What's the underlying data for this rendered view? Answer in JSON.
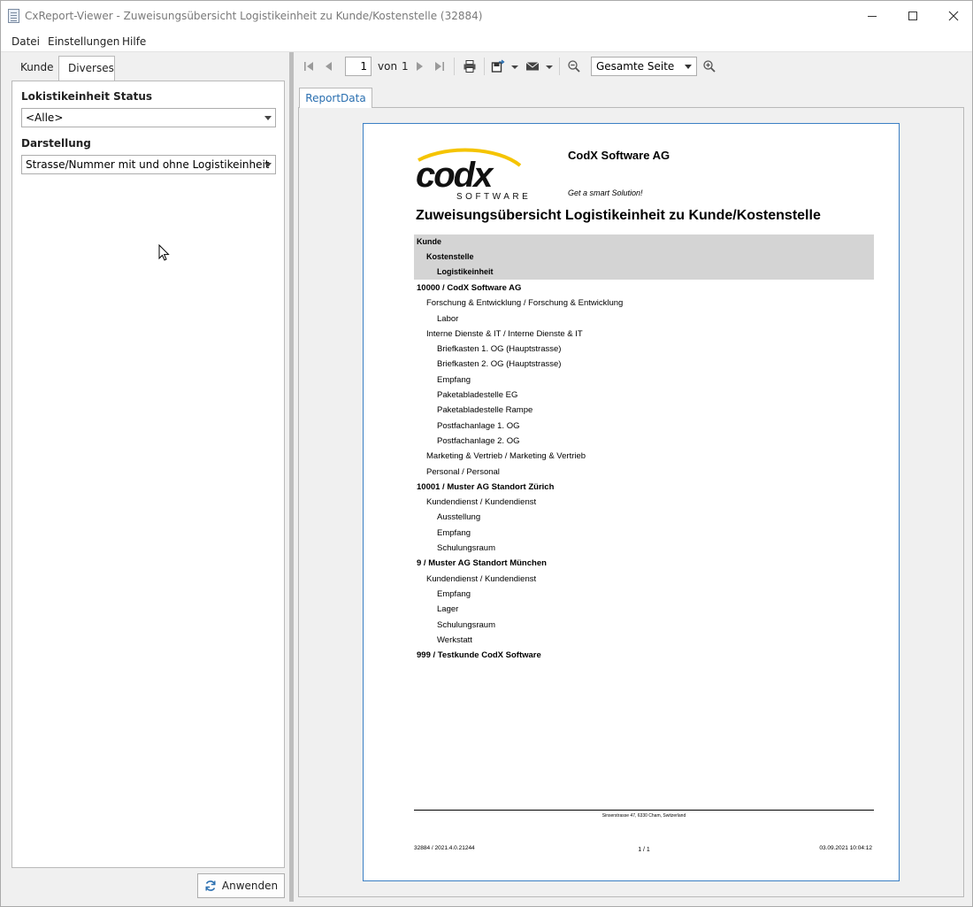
{
  "window": {
    "title": "CxReport-Viewer - Zuweisungsübersicht Logistikeinheit zu Kunde/Kostenstelle (32884)"
  },
  "menu": {
    "items": [
      {
        "label": "Datei"
      },
      {
        "label": "Einstellungen"
      },
      {
        "label": "Hilfe"
      }
    ]
  },
  "left": {
    "tabs": [
      {
        "label": "Kunde",
        "active": false
      },
      {
        "label": "Diverses",
        "active": true
      }
    ],
    "status_label": "Lokistikeinheit Status",
    "status_value": "<Alle>",
    "display_label": "Darstellung",
    "display_value": "Strasse/Nummer mit und ohne Logistikeinheit",
    "apply_label": "Anwenden"
  },
  "toolbar": {
    "page_current": "1",
    "page_of_label": "von",
    "page_total": "1",
    "zoom_value": "Gesamte Seite"
  },
  "report_tab": {
    "label": "ReportData"
  },
  "report": {
    "company": "CodX Software AG",
    "slogan": "Get a smart Solution!",
    "logo_text": "codx",
    "logo_subtext": "SOFTWARE",
    "title": "Zuweisungsübersicht Logistikeinheit zu Kunde/Kostenstelle",
    "header_kunde": "Kunde",
    "header_kostenstelle": "Kostenstelle",
    "header_logistik": "Logistikeinheit",
    "rows": [
      {
        "level": 0,
        "text": "10000 / CodX Software AG"
      },
      {
        "level": 1,
        "text": "Forschung & Entwicklung / Forschung & Entwicklung"
      },
      {
        "level": 2,
        "text": "Labor"
      },
      {
        "level": 1,
        "text": "Interne Dienste & IT / Interne Dienste & IT"
      },
      {
        "level": 2,
        "text": "Briefkasten 1. OG (Hauptstrasse)"
      },
      {
        "level": 2,
        "text": "Briefkasten 2. OG  (Hauptstrasse)"
      },
      {
        "level": 2,
        "text": "Empfang"
      },
      {
        "level": 2,
        "text": "Paketabladestelle EG"
      },
      {
        "level": 2,
        "text": "Paketabladestelle Rampe"
      },
      {
        "level": 2,
        "text": "Postfachanlage 1. OG"
      },
      {
        "level": 2,
        "text": "Postfachanlage 2. OG"
      },
      {
        "level": 1,
        "text": "Marketing & Vertrieb / Marketing & Vertrieb"
      },
      {
        "level": 1,
        "text": "Personal / Personal"
      },
      {
        "level": 0,
        "text": "10001 / Muster AG Standort Zürich"
      },
      {
        "level": 1,
        "text": "Kundendienst / Kundendienst"
      },
      {
        "level": 2,
        "text": "Ausstellung"
      },
      {
        "level": 2,
        "text": "Empfang"
      },
      {
        "level": 2,
        "text": "Schulungsraum"
      },
      {
        "level": 0,
        "text": "9 / Muster AG Standort München"
      },
      {
        "level": 1,
        "text": "Kundendienst / Kundendienst"
      },
      {
        "level": 2,
        "text": "Empfang"
      },
      {
        "level": 2,
        "text": "Lager"
      },
      {
        "level": 2,
        "text": "Schulungsraum"
      },
      {
        "level": 2,
        "text": "Werkstatt"
      },
      {
        "level": 0,
        "text": "999 / Testkunde CodX Software"
      }
    ],
    "footer_address": "Sinserstrasse 47, 6330 Cham, Switzerland",
    "footer_left": "32884 / 2021.4.0.21244",
    "footer_center": "1 / 1",
    "footer_right": "03.09.2021 10:04:12"
  },
  "colors": {
    "accent": "#3b7fc4",
    "logo_yellow": "#f5c400",
    "header_gray": "#d4d4d4"
  },
  "icons": [
    "app-icon",
    "first-page-icon",
    "prev-page-icon",
    "next-page-icon",
    "last-page-icon",
    "print-icon",
    "export-icon",
    "mail-icon",
    "zoom-out-icon",
    "zoom-in-icon",
    "refresh-icon",
    "cursor-icon"
  ]
}
